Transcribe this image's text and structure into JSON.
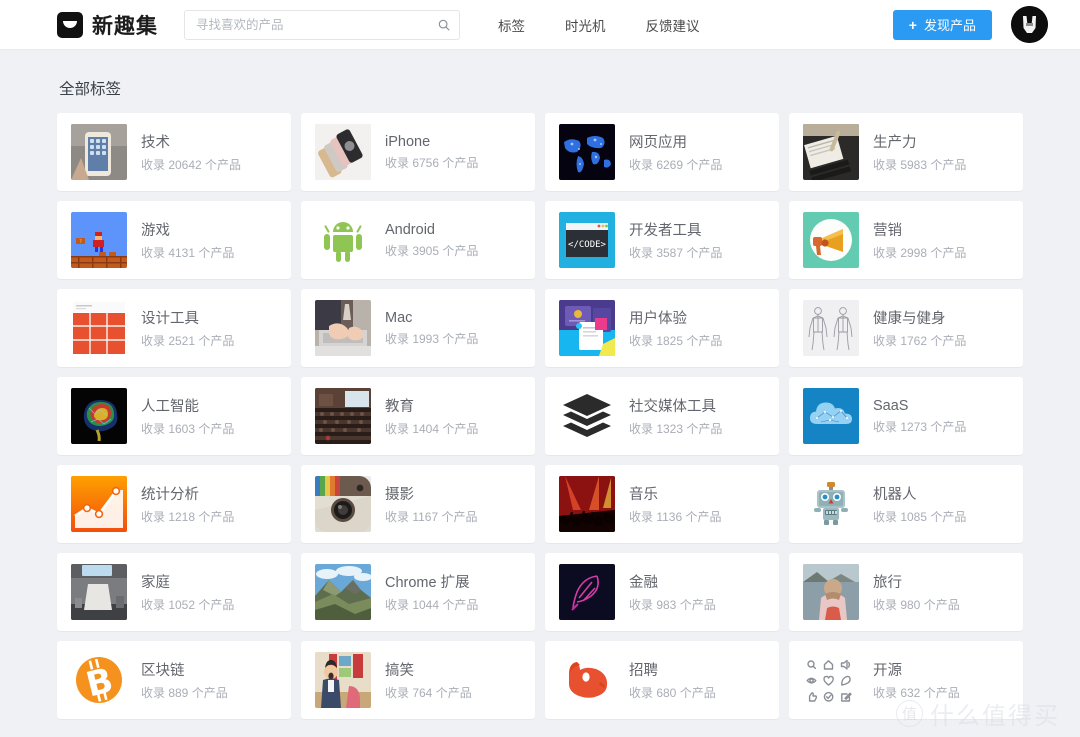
{
  "header": {
    "logo_icon": "smile-bowl-logo-icon",
    "brand_name": "新趣集",
    "search": {
      "placeholder": "寻找喜欢的产品",
      "value": "",
      "icon": "search-icon"
    },
    "nav": [
      {
        "label": "标签"
      },
      {
        "label": "时光机"
      },
      {
        "label": "反馈建议"
      }
    ],
    "discover_button": {
      "plus": "+",
      "label": "发现产品",
      "color": "#2b9af3"
    },
    "avatar_icon": "user-avatar-icon"
  },
  "main": {
    "page_title": "全部标签",
    "count_prefix": "收录",
    "count_suffix": "个产品",
    "tags": [
      {
        "name": "技术",
        "count": "20642",
        "count_text": "收录 20642 个产品",
        "thumb": "iphone-in-hand-photo"
      },
      {
        "name": "iPhone",
        "count": "6756",
        "count_text": "收录 6756 个产品",
        "thumb": "iphone-lineup-photo"
      },
      {
        "name": "网页应用",
        "count": "6269",
        "count_text": "收录 6269 个产品",
        "thumb": "blue-world-map-icon"
      },
      {
        "name": "生产力",
        "count": "5983",
        "count_text": "收录 5983 个产品",
        "thumb": "desk-notebook-photo"
      },
      {
        "name": "游戏",
        "count": "4131",
        "count_text": "收录 4131 个产品",
        "thumb": "mario-pixel-game-icon"
      },
      {
        "name": "Android",
        "count": "3905",
        "count_text": "收录 3905 个产品",
        "thumb": "android-robot-icon"
      },
      {
        "name": "开发者工具",
        "count": "3587",
        "count_text": "收录 3587 个产品",
        "thumb": "code-window-icon"
      },
      {
        "name": "营销",
        "count": "2998",
        "count_text": "收录 2998 个产品",
        "thumb": "megaphone-icon"
      },
      {
        "name": "设计工具",
        "count": "2521",
        "count_text": "收录 2521 个产品",
        "thumb": "red-grid-layout-icon"
      },
      {
        "name": "Mac",
        "count": "1993",
        "count_text": "收录 1993 个产品",
        "thumb": "laptop-typing-photo"
      },
      {
        "name": "用户体验",
        "count": "1825",
        "count_text": "收录 1825 个产品",
        "thumb": "ui-cards-icon"
      },
      {
        "name": "健康与健身",
        "count": "1762",
        "count_text": "收录 1762 个产品",
        "thumb": "anatomy-figures-icon"
      },
      {
        "name": "人工智能",
        "count": "1603",
        "count_text": "收录 1603 个产品",
        "thumb": "colorful-brain-icon"
      },
      {
        "name": "教育",
        "count": "1404",
        "count_text": "收录 1404 个产品",
        "thumb": "lecture-hall-photo"
      },
      {
        "name": "社交媒体工具",
        "count": "1323",
        "count_text": "收录 1323 个产品",
        "thumb": "stacked-layers-icon"
      },
      {
        "name": "SaaS",
        "count": "1273",
        "count_text": "收录 1273 个产品",
        "thumb": "blue-cloud-icon"
      },
      {
        "name": "统计分析",
        "count": "1218",
        "count_text": "收录 1218 个产品",
        "thumb": "orange-chart-icon"
      },
      {
        "name": "摄影",
        "count": "1167",
        "count_text": "收录 1167 个产品",
        "thumb": "instagram-camera-icon"
      },
      {
        "name": "音乐",
        "count": "1136",
        "count_text": "收录 1136 个产品",
        "thumb": "concert-crowd-photo"
      },
      {
        "name": "机器人",
        "count": "1085",
        "count_text": "收录 1085 个产品",
        "thumb": "tin-robot-icon"
      },
      {
        "name": "家庭",
        "count": "1052",
        "count_text": "收录 1052 个产品",
        "thumb": "interior-room-photo"
      },
      {
        "name": "Chrome 扩展",
        "count": "1044",
        "count_text": "收录 1044 个产品",
        "thumb": "mountain-landscape-photo"
      },
      {
        "name": "金融",
        "count": "983",
        "count_text": "收录 983 个产品",
        "thumb": "robinhood-feather-icon"
      },
      {
        "name": "旅行",
        "count": "980",
        "count_text": "收录 980 个产品",
        "thumb": "traveler-lake-photo"
      },
      {
        "name": "区块链",
        "count": "889",
        "count_text": "收录 889 个产品",
        "thumb": "bitcoin-coin-icon"
      },
      {
        "name": "搞笑",
        "count": "764",
        "count_text": "收录 764 个产品",
        "thumb": "cartoon-person-icon"
      },
      {
        "name": "招聘",
        "count": "680",
        "count_text": "收录 680 个产品",
        "thumb": "orange-fox-head-icon"
      },
      {
        "name": "开源",
        "count": "632",
        "count_text": "收录 632 个产品",
        "thumb": "icon-grid-nine-icon"
      }
    ]
  },
  "watermark": {
    "badge": "值",
    "text": "什么值得买"
  }
}
